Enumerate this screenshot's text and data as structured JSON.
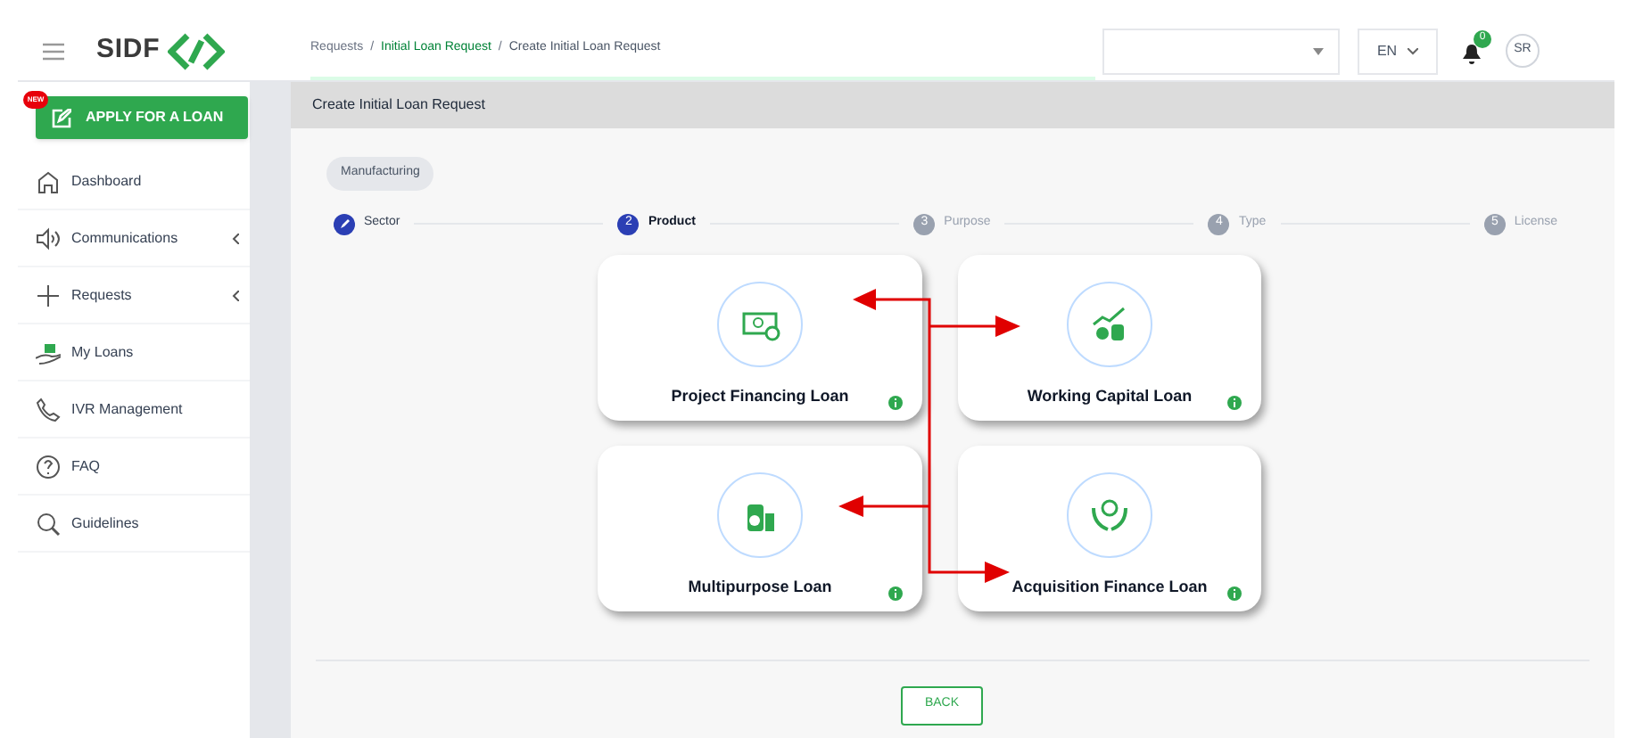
{
  "header": {
    "logo": "SIDF",
    "breadcrumb": [
      "Requests",
      "Initial Loan Request",
      "Create Initial Loan Request"
    ],
    "breadcrumb_separators": [
      "/",
      "/"
    ],
    "language": "EN",
    "notifications": "0",
    "avatar": "SR"
  },
  "sidebar": {
    "apply_button": {
      "label": "APPLY FOR A LOAN",
      "badge": "NEW"
    },
    "items": [
      {
        "label": "Dashboard",
        "expandable": false
      },
      {
        "label": "Communications",
        "expandable": true
      },
      {
        "label": "Requests",
        "expandable": true
      },
      {
        "label": "My Loans",
        "expandable": false
      },
      {
        "label": "IVR Management",
        "expandable": false
      },
      {
        "label": "FAQ",
        "expandable": false
      },
      {
        "label": "Guidelines",
        "expandable": false
      }
    ]
  },
  "page": {
    "title": "Create Initial Loan Request",
    "sector_chip": "Manufacturing",
    "steps": [
      {
        "label": "Sector",
        "completed": true,
        "selected": false
      },
      {
        "label": "Product",
        "number": "2",
        "completed": false,
        "selected": true
      },
      {
        "label": "Purpose",
        "number": "3",
        "completed": false,
        "selected": false
      },
      {
        "label": "Type",
        "number": "4",
        "completed": false,
        "selected": false
      },
      {
        "label": "License",
        "number": "5",
        "completed": false,
        "selected": false
      }
    ],
    "products": [
      {
        "label": "Project Financing Loan"
      },
      {
        "label": "Working Capital Loan"
      },
      {
        "label": "Multipurpose Loan"
      },
      {
        "label": "Acquisition Finance Loan"
      }
    ],
    "back_button": "BACK"
  }
}
